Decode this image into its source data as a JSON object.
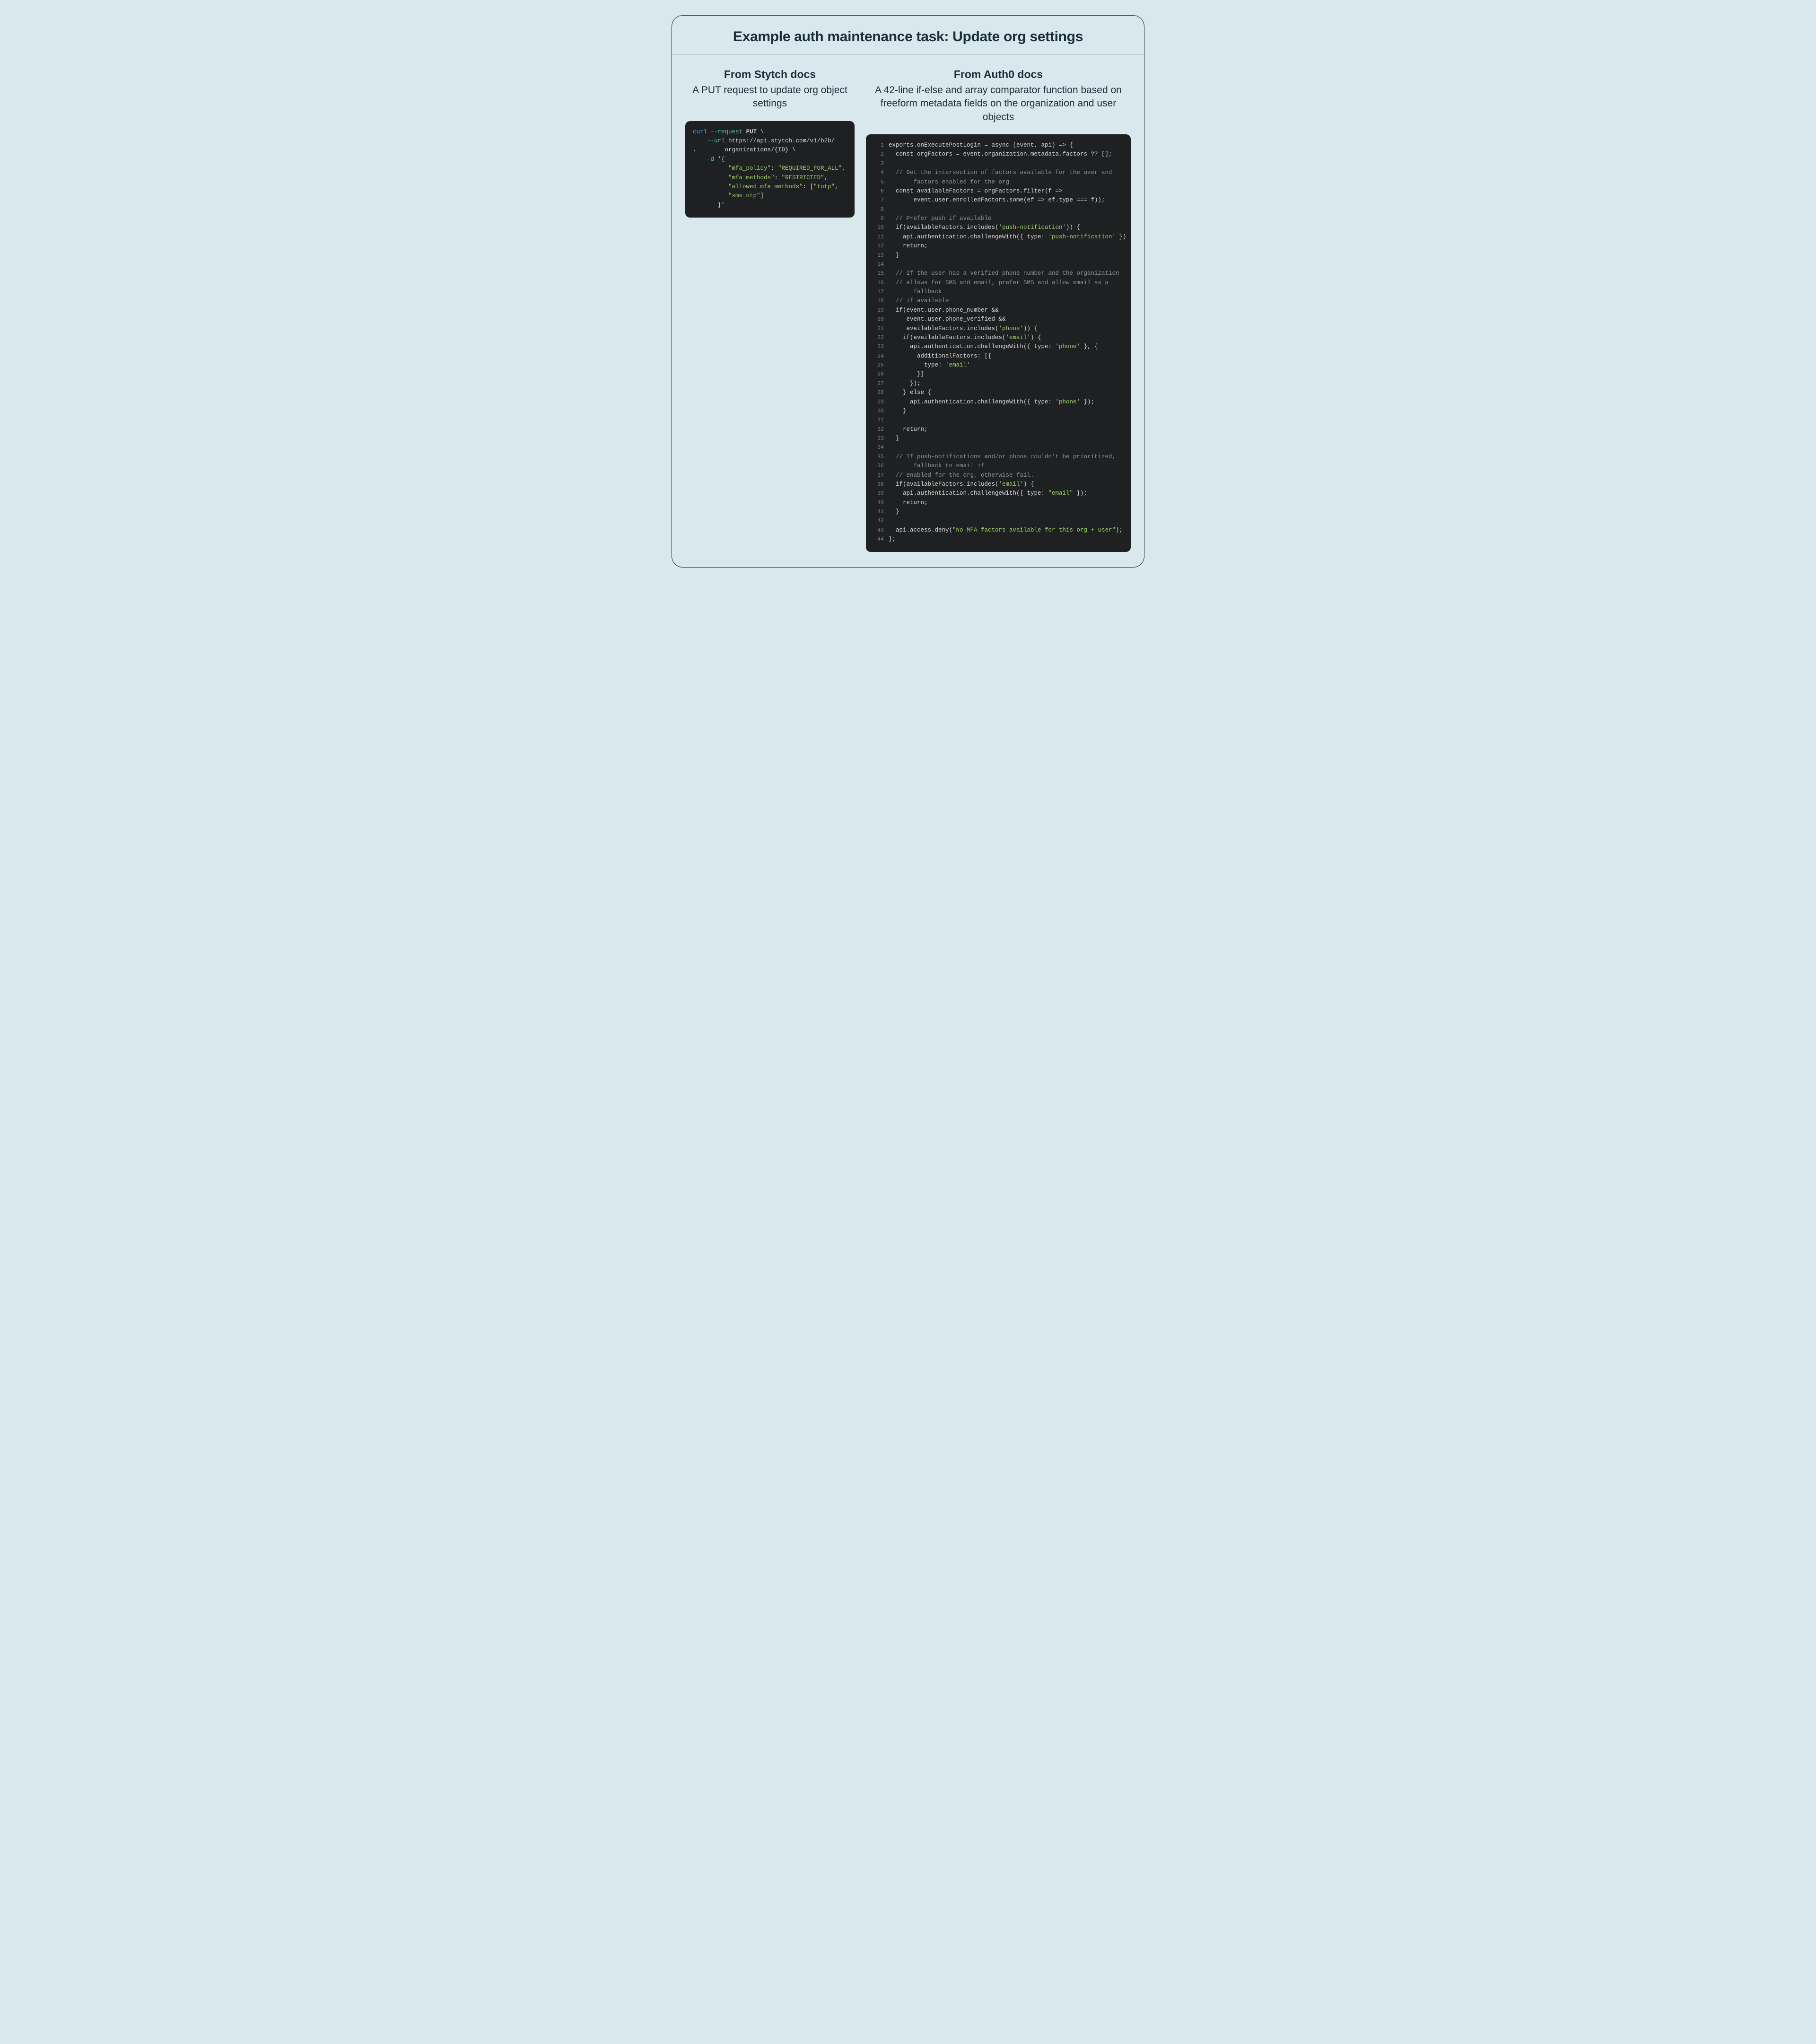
{
  "header": {
    "title": "Example auth maintenance task: Update org settings"
  },
  "left": {
    "title": "From Stytch docs",
    "subtitle": "A PUT request to update org object settings",
    "code": [
      [
        {
          "t": "kw",
          "v": "curl"
        },
        {
          "t": "pt",
          "v": " "
        },
        {
          "t": "flag",
          "v": "--request"
        },
        {
          "t": "pt",
          "v": " "
        },
        {
          "t": "meth",
          "v": "PUT"
        },
        {
          "t": "pt",
          "v": " \\"
        }
      ],
      [
        {
          "t": "pt",
          "v": "    "
        },
        {
          "t": "flag",
          "v": "--url"
        },
        {
          "t": "pt",
          "v": " https://api.stytch.com/v1/b2b/"
        }
      ],
      [
        {
          "t": "pt",
          "v": ".        organizations/{ID} \\"
        }
      ],
      [
        {
          "t": "pt",
          "v": "    "
        },
        {
          "t": "flag",
          "v": "-d"
        },
        {
          "t": "pt",
          "v": " '{"
        }
      ],
      [
        {
          "t": "pt",
          "v": "          "
        },
        {
          "t": "str",
          "v": "\"mfa_policy\""
        },
        {
          "t": "pt",
          "v": ": "
        },
        {
          "t": "str",
          "v": "\"REQUIRED_FOR_ALL\""
        },
        {
          "t": "pt",
          "v": ","
        }
      ],
      [
        {
          "t": "pt",
          "v": "          "
        },
        {
          "t": "str",
          "v": "\"mfa_methods\""
        },
        {
          "t": "pt",
          "v": ": "
        },
        {
          "t": "str",
          "v": "\"RESTRICTED\""
        },
        {
          "t": "pt",
          "v": ","
        }
      ],
      [
        {
          "t": "pt",
          "v": "          "
        },
        {
          "t": "str",
          "v": "\"allowed_mfa_methods\""
        },
        {
          "t": "pt",
          "v": ": ["
        },
        {
          "t": "str",
          "v": "\"totp\""
        },
        {
          "t": "pt",
          "v": ","
        }
      ],
      [
        {
          "t": "pt",
          "v": "          "
        },
        {
          "t": "str",
          "v": "\"sms_otp\""
        },
        {
          "t": "pt",
          "v": "]"
        }
      ],
      [
        {
          "t": "pt",
          "v": "       }'"
        }
      ]
    ]
  },
  "right": {
    "title": "From Auth0 docs",
    "subtitle": "A 42-line if-else and array comparator function based on freeform metadata fields on the organization and user objects",
    "code": [
      [
        {
          "t": "pt",
          "v": "exports.onExecutePostLogin = async (event, api) => {"
        }
      ],
      [
        {
          "t": "pt",
          "v": "  const orgFactors = event.organization.metadata.factors ?? [];"
        }
      ],
      [],
      [
        {
          "t": "pt",
          "v": "  "
        },
        {
          "t": "com",
          "v": "// Get the intersection of factors available for the user and"
        }
      ],
      [
        {
          "t": "pt",
          "v": "       "
        },
        {
          "t": "com",
          "v": "factors enabled for the org"
        }
      ],
      [
        {
          "t": "pt",
          "v": "  const availableFactors = orgFactors.filter(f =>"
        }
      ],
      [
        {
          "t": "pt",
          "v": "       event.user.enrolledFactors.some(ef => ef.type === f));"
        }
      ],
      [],
      [
        {
          "t": "pt",
          "v": "  "
        },
        {
          "t": "com",
          "v": "// Prefer push if available"
        }
      ],
      [
        {
          "t": "pt",
          "v": "  if(availableFactors.includes("
        },
        {
          "t": "str",
          "v": "'push-notification'"
        },
        {
          "t": "pt",
          "v": ")) {"
        }
      ],
      [
        {
          "t": "pt",
          "v": "    api.authentication.challengeWith({ type: "
        },
        {
          "t": "str",
          "v": "'push-notification'"
        },
        {
          "t": "pt",
          "v": " })"
        }
      ],
      [
        {
          "t": "pt",
          "v": "    return;"
        }
      ],
      [
        {
          "t": "pt",
          "v": "  }"
        }
      ],
      [],
      [
        {
          "t": "pt",
          "v": "  "
        },
        {
          "t": "com",
          "v": "// If the user has a verified phone number and the organization"
        }
      ],
      [
        {
          "t": "pt",
          "v": "  "
        },
        {
          "t": "com",
          "v": "// allows for SMS and email, prefer SMS and allow email as a"
        }
      ],
      [
        {
          "t": "pt",
          "v": "       "
        },
        {
          "t": "com",
          "v": "fallback"
        }
      ],
      [
        {
          "t": "pt",
          "v": "  "
        },
        {
          "t": "com",
          "v": "// if available"
        }
      ],
      [
        {
          "t": "pt",
          "v": "  if(event.user.phone_number &&"
        }
      ],
      [
        {
          "t": "pt",
          "v": "     event.user.phone_verified &&"
        }
      ],
      [
        {
          "t": "pt",
          "v": "     availableFactors.includes("
        },
        {
          "t": "str",
          "v": "'phone'"
        },
        {
          "t": "pt",
          "v": ")) {"
        }
      ],
      [
        {
          "t": "pt",
          "v": "    if(availableFactors.includes("
        },
        {
          "t": "str",
          "v": "'email'"
        },
        {
          "t": "pt",
          "v": ") {"
        }
      ],
      [
        {
          "t": "pt",
          "v": "      api.authentication.challengeWith({ type: "
        },
        {
          "t": "str",
          "v": "'phone'"
        },
        {
          "t": "pt",
          "v": " }, {"
        }
      ],
      [
        {
          "t": "pt",
          "v": "        additionalFactors: [{"
        }
      ],
      [
        {
          "t": "pt",
          "v": "          type: "
        },
        {
          "t": "str",
          "v": "'email'"
        }
      ],
      [
        {
          "t": "pt",
          "v": "        }]"
        }
      ],
      [
        {
          "t": "pt",
          "v": "      });"
        }
      ],
      [
        {
          "t": "pt",
          "v": "    } else {"
        }
      ],
      [
        {
          "t": "pt",
          "v": "      api.authentication.challengeWith({ type: "
        },
        {
          "t": "str",
          "v": "'phone'"
        },
        {
          "t": "pt",
          "v": " });"
        }
      ],
      [
        {
          "t": "pt",
          "v": "    }"
        }
      ],
      [],
      [
        {
          "t": "pt",
          "v": "    return;"
        }
      ],
      [
        {
          "t": "pt",
          "v": "  }"
        }
      ],
      [],
      [
        {
          "t": "pt",
          "v": "  "
        },
        {
          "t": "com",
          "v": "// If push-notifications and/or phone couldn't be prioritized,"
        }
      ],
      [
        {
          "t": "pt",
          "v": "       "
        },
        {
          "t": "com",
          "v": "fallback to email if"
        }
      ],
      [
        {
          "t": "pt",
          "v": "  "
        },
        {
          "t": "com",
          "v": "// enabled for the org, otherwise fail."
        }
      ],
      [
        {
          "t": "pt",
          "v": "  if(availableFactors.includes("
        },
        {
          "t": "str",
          "v": "'email'"
        },
        {
          "t": "pt",
          "v": ") {"
        }
      ],
      [
        {
          "t": "pt",
          "v": "    api.authentication.challengeWith({ type: "
        },
        {
          "t": "str",
          "v": "\"email\""
        },
        {
          "t": "pt",
          "v": " });"
        }
      ],
      [
        {
          "t": "pt",
          "v": "    return;"
        }
      ],
      [
        {
          "t": "pt",
          "v": "  }"
        }
      ],
      [],
      [
        {
          "t": "pt",
          "v": "  api.access.deny("
        },
        {
          "t": "str",
          "v": "\"No MFA factors available for this org + user\""
        },
        {
          "t": "pt",
          "v": ");"
        }
      ],
      [
        {
          "t": "pt",
          "v": "};"
        }
      ]
    ]
  }
}
